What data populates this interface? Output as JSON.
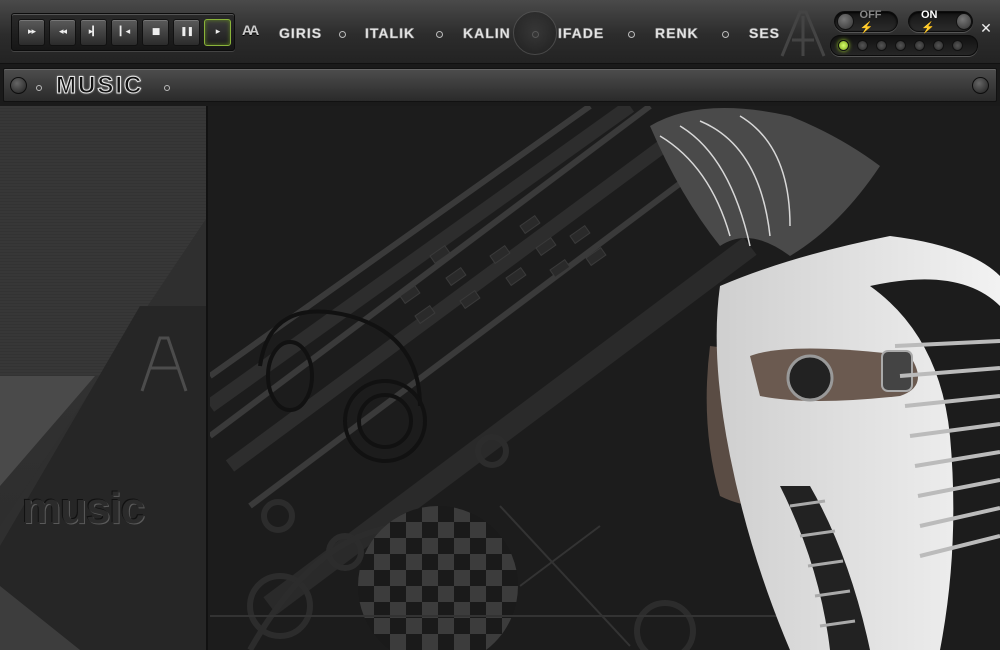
{
  "player": {
    "buttons": [
      {
        "name": "fast-forward-button",
        "glyph": "▸▸"
      },
      {
        "name": "rewind-button",
        "glyph": "◂◂"
      },
      {
        "name": "next-track-button",
        "glyph": "▸▎"
      },
      {
        "name": "previous-track-button",
        "glyph": "▎◂"
      },
      {
        "name": "stop-button",
        "glyph": "■"
      },
      {
        "name": "pause-button",
        "glyph": "❚❚"
      },
      {
        "name": "play-button",
        "glyph": "▸"
      }
    ]
  },
  "logo": {
    "text": "AA"
  },
  "nav": {
    "items": [
      "GIRIS",
      "ITALIK",
      "KALIN",
      "IFADE",
      "RENK",
      "SES"
    ]
  },
  "switches": {
    "off_label": "OFF ⚡",
    "on_label": "ON ⚡"
  },
  "close_glyph": "✕",
  "leds": [
    true,
    false,
    false,
    false,
    false,
    false,
    false
  ],
  "title": {
    "text": "MUSIC"
  },
  "side_word": "music",
  "colors": {
    "led_on": "#9fd22a",
    "play_border": "#8ab33a"
  }
}
